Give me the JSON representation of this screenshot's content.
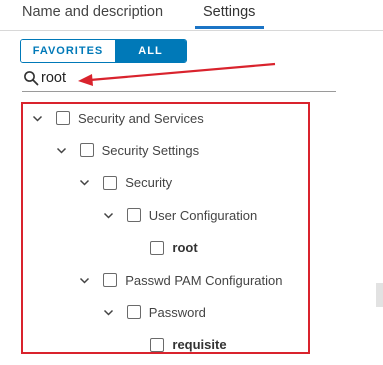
{
  "tabs": [
    {
      "label": "Name and description"
    },
    {
      "label": "Settings"
    }
  ],
  "filter": {
    "favorites_label": "FAVORITES",
    "all_label": "ALL",
    "selected": "ALL"
  },
  "search": {
    "value": "root"
  },
  "tree": [
    {
      "label": "Security and Services",
      "level": 0,
      "expanded": true,
      "bold": false,
      "checked": false
    },
    {
      "label": "Security Settings",
      "level": 1,
      "expanded": true,
      "bold": false,
      "checked": false
    },
    {
      "label": "Security",
      "level": 2,
      "expanded": true,
      "bold": false,
      "checked": false
    },
    {
      "label": "User Configuration",
      "level": 3,
      "expanded": true,
      "bold": false,
      "checked": false
    },
    {
      "label": "root",
      "level": 4,
      "expanded": false,
      "bold": true,
      "checked": false
    },
    {
      "label": "Passwd PAM Configuration",
      "level": 2,
      "expanded": true,
      "bold": false,
      "checked": false
    },
    {
      "label": "Password",
      "level": 3,
      "expanded": true,
      "bold": false,
      "checked": false
    },
    {
      "label": "requisite",
      "level": 4,
      "expanded": false,
      "bold": true,
      "checked": false
    }
  ],
  "colors": {
    "accent": "#0079b8",
    "annotation": "#d9232d"
  },
  "icons": {
    "search": "search-icon",
    "expand": "chevron-down-icon"
  }
}
